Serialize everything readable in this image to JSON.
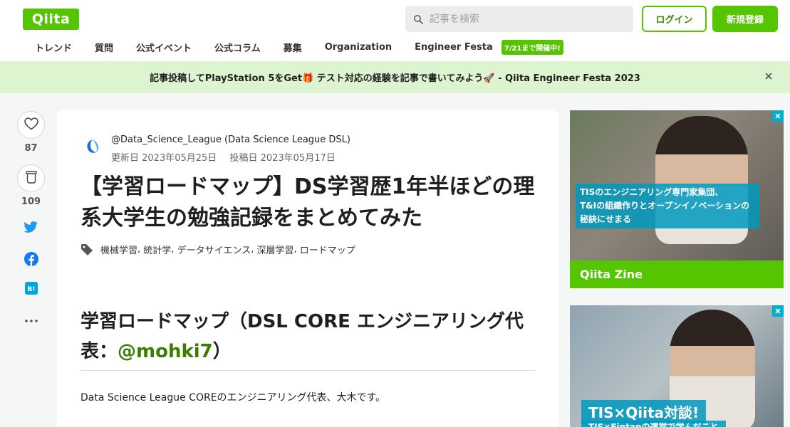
{
  "header": {
    "logo": "Qiita",
    "search_placeholder": "記事を検索",
    "login": "ログイン",
    "signup": "新規登録"
  },
  "nav": {
    "items": [
      "トレンド",
      "質問",
      "公式イベント",
      "公式コラム",
      "募集",
      "Organization",
      "Engineer Festa"
    ],
    "badge": "7/21まで開催中!"
  },
  "banner": {
    "text": "記事投稿してPlayStation 5をGet🎁 テスト対応の経験を記事で書いてみよう🚀 - Qiita Engineer Festa 2023"
  },
  "rail": {
    "likes": "87",
    "stocks": "109"
  },
  "article": {
    "author": "@Data_Science_League (Data Science League DSL)",
    "updated": "更新日 2023年05月25日",
    "posted": "投稿日 2023年05月17日",
    "title": "【学習ロードマップ】DS学習歴1年半ほどの理系大学生の勉強記録をまとめてみた",
    "tags": [
      "機械学習",
      "統計学",
      "データサイエンス",
      "深層学習",
      "ロードマップ"
    ],
    "h2_prefix": "学習ロードマップ（DSL CORE エンジニアリング代表：",
    "h2_mention": "@mohki7",
    "h2_suffix": "）",
    "paragraph": "Data Science League COREのエンジニアリング代表、大木です。"
  },
  "ads": {
    "ad1_caption_line1": "TISのエンジニアリング専門家集団、",
    "ad1_caption_line2": "T&Iの組織作りとオープンイノベーションの",
    "ad1_caption_line3": "秘訣にせまる",
    "ad1_footer": "Qiita Zine",
    "ad2_title": "TIS×Qiita対談!",
    "ad2_sub": "TIS×Fintanの運営で学んだこと"
  },
  "colors": {
    "brand": "#55c500",
    "banner_bg": "#dcf5d0",
    "mention": "#3a7d00",
    "twitter": "#1d9bf0",
    "facebook": "#1877f2",
    "hatena": "#00a4de"
  }
}
